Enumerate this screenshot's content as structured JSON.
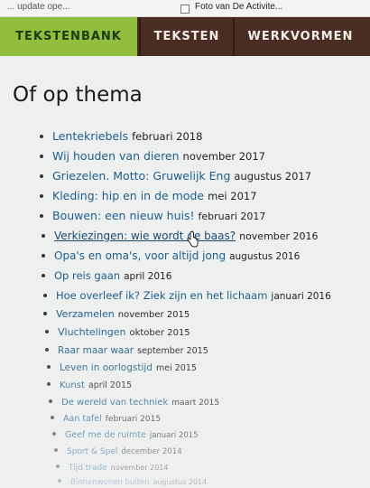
{
  "topbar": {
    "left_text": "... update ope...",
    "right_text": "Foto van De Activite..."
  },
  "nav": {
    "tabs": [
      {
        "label": "TEKSTENBANK"
      },
      {
        "label": "TEKSTEN"
      },
      {
        "label": "WERKVORMEN"
      }
    ]
  },
  "heading": "Of op thema",
  "themes": [
    {
      "title": "Lentekriebels",
      "date": "februari 2018"
    },
    {
      "title": "Wij houden van dieren",
      "date": "november 2017"
    },
    {
      "title": "Griezelen. Motto: Gruwelijk Eng",
      "date": "augustus 2017"
    },
    {
      "title": "Kleding: hip en in de mode",
      "date": "mei 2017"
    },
    {
      "title": "Bouwen: een nieuw huis!",
      "date": "februari 2017"
    },
    {
      "title": "Verkiezingen: wie wordt de baas?",
      "date": "november 2016"
    },
    {
      "title": "Opa's en oma's, voor altijd jong",
      "date": "augustus 2016"
    },
    {
      "title": "Op reis gaan",
      "date": "april 2016"
    },
    {
      "title": "Hoe overleef ik? Ziek zijn en het lichaam",
      "date": "januari 2016"
    },
    {
      "title": "Verzamelen",
      "date": "november 2015"
    },
    {
      "title": "Vluchtelingen",
      "date": "oktober 2015"
    },
    {
      "title": "Raar maar waar",
      "date": "september 2015"
    },
    {
      "title": "Leven in oorlogstijd",
      "date": "mei 2015"
    },
    {
      "title": "Kunst",
      "date": "april 2015"
    },
    {
      "title": "De wereld van techniek",
      "date": "maart 2015"
    },
    {
      "title": "Aan tafel",
      "date": "februari 2015"
    },
    {
      "title": "Geef me de ruimte",
      "date": "januari 2015"
    },
    {
      "title": "Sport & Spel",
      "date": "december 2014"
    },
    {
      "title": "Tijd trade",
      "date": "november 2014"
    },
    {
      "title": "Binnenwonen buiten",
      "date": "augustus 2014"
    }
  ]
}
